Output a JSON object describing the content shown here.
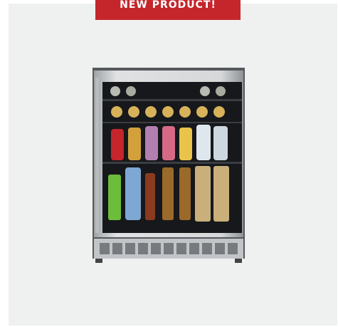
{
  "badge": {
    "label": "NEW PRODUCT!"
  },
  "product": {
    "image": "beverage-refrigerator-glass-door"
  },
  "colors": {
    "badge": "#c4262c",
    "card": "#eff1f0",
    "steel": "#c9ccce",
    "interior": "#1a1c1f"
  }
}
